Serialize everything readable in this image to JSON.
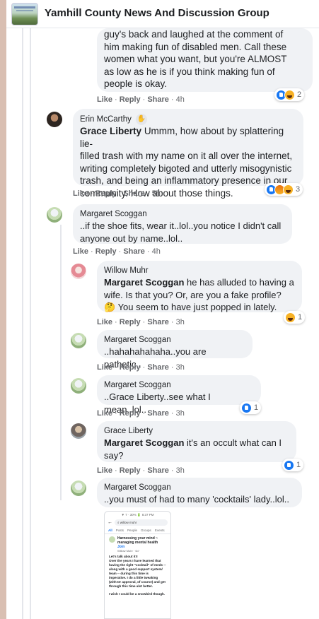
{
  "header": {
    "group_name": "Yamhill County News And Discussion Group",
    "thumb_text": "Yamhill County News"
  },
  "comments": [
    {
      "author": "",
      "lines": [
        "guy's back and laughed at the comment of",
        "him making fun of disabled men. Call these",
        "women what you want, but you're ALMOST",
        "as low as he is if you think making fun of",
        "people is okay."
      ],
      "actions": {
        "like": "Like",
        "reply": "Reply",
        "share": "Share",
        "time": "4h"
      },
      "reaction_count": "2"
    },
    {
      "author": "Erin McCarthy",
      "author_badge": "fan-badge-icon",
      "mention": "Grace Liberty",
      "lines": [
        "Ummm, how about by splattering lie-",
        "filled trash with my name on it all over the internet,",
        "writing completely bigoted and utterly misogynistic",
        "trash, and being an inflammatory presence in our",
        "community. How about those things."
      ],
      "actions": {
        "like": "Like",
        "reply": "Reply",
        "share": "Share",
        "time": "5h"
      },
      "reaction_count": "3"
    },
    {
      "author": "Margaret Scoggan",
      "lines": [
        "..if the shoe fits, wear it..lol..you notice I didn't call",
        "anyone out by name..lol.."
      ],
      "actions": {
        "like": "Like",
        "reply": "Reply",
        "share": "Share",
        "time": "4h"
      }
    },
    {
      "author": "Willow Muhr",
      "mention": "Margaret Scoggan",
      "lines": [
        "he has alluded to having a",
        "wife. Is that you? Or, are you a fake profile?",
        "🤔 You seem to have just popped in lately."
      ],
      "actions": {
        "like": "Like",
        "reply": "Reply",
        "share": "Share",
        "time": "3h"
      },
      "reaction_count": "1"
    },
    {
      "author": "Margaret Scoggan",
      "lines": [
        "..hahahahahaha..you are pathetic.."
      ],
      "actions": {
        "like": "Like",
        "reply": "Reply",
        "share": "Share",
        "time": "3h"
      }
    },
    {
      "author": "Margaret Scoggan",
      "lines": [
        "..Grace Liberty..see what I mean..lol.."
      ],
      "actions": {
        "like": "Like",
        "reply": "Reply",
        "share": "Share",
        "time": "3h"
      },
      "reaction_count": "1"
    },
    {
      "author": "Grace Liberty",
      "mention": "Margaret Scoggan",
      "lines": [
        "it's an occult what can I",
        "say?"
      ],
      "actions": {
        "like": "Like",
        "reply": "Reply",
        "share": "Share",
        "time": "3h"
      },
      "reaction_count": "1"
    },
    {
      "author": "Margaret Scoggan",
      "lines": [
        "..you must of had to many 'cocktails' lady..lol.."
      ]
    }
  ],
  "attachment": {
    "status": "▼ 7 · 30% 🔋 8:37 PM",
    "search_text": "willow muhr",
    "tabs": [
      "All",
      "Posts",
      "People",
      "Groups",
      "Events"
    ],
    "post_title": "Harnessing your mind ~ managing mental health",
    "join": "Join",
    "meta": "Willow Muhr · 6d ·",
    "body_lines": [
      "Let's talk about it!!",
      "Over the years I have learned that",
      "having the right \"cocktail\" of meds --",
      "along with a good support system/",
      "team -- during this time is",
      "imperative.  I do a little tweaking",
      "(with Dr approval, of course) and get",
      "through this time alot better.",
      "",
      "I wish I could be a snowbird though."
    ]
  }
}
